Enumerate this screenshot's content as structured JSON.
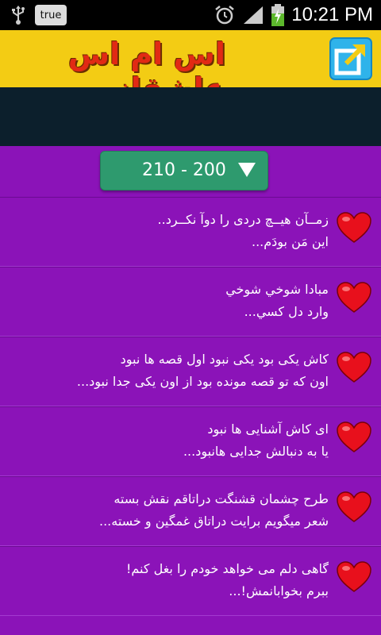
{
  "status_bar": {
    "badge": "true",
    "time": "10:21 PM",
    "icons": [
      "usb-icon",
      "alarm-icon",
      "signal-icon",
      "battery-charging-icon"
    ]
  },
  "header": {
    "title": "اس ام اس عاشقانه",
    "share_icon": "share-icon"
  },
  "range_selector": {
    "value": "210 - 200"
  },
  "messages": [
    {
      "line1": "زمــآن هیــچ دردی را دوآ نکــرد..",
      "line2": "این مَن بودَم..."
    },
    {
      "line1": "مبادا شوخي شوخي",
      "line2": "وارد دل كسي..."
    },
    {
      "line1": "کاش یکی بود یکی نبود اول قصه ها نبود",
      "line2": "اون که تو قصه مونده بود از اون یکی جدا نبود..."
    },
    {
      "line1": "ای کاش آشنایی ها نبود",
      "line2": "یا به دنبالش جدایی هانبود..."
    },
    {
      "line1": "طرح چشمان قشنگت دراتاقم نقش بسته",
      "line2": "شعر میگویم برایت دراتاق غمگین و خسته..."
    },
    {
      "line1": "گاهی دلم می خواهد خودم را بغل کنم!",
      "line2": "ببرم بخوابانمش!..."
    }
  ],
  "colors": {
    "background": "#8b13b8",
    "header": "#f3cc14",
    "title": "#e12a14",
    "selector": "#2e9a6e",
    "ad_bar": "#0c1f2c"
  }
}
